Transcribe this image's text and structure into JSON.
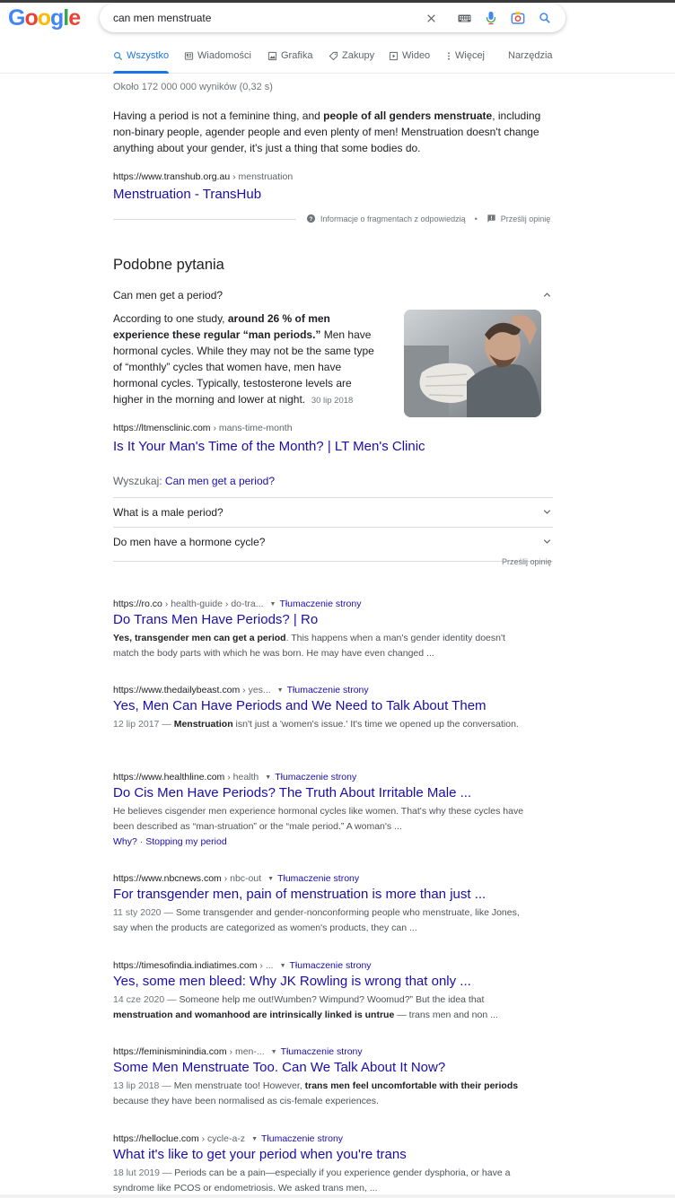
{
  "logo": {
    "letters": [
      {
        "ch": "G",
        "color": "#4285F4"
      },
      {
        "ch": "o",
        "color": "#EA4335"
      },
      {
        "ch": "o",
        "color": "#FBBC05"
      },
      {
        "ch": "g",
        "color": "#4285F4"
      },
      {
        "ch": "l",
        "color": "#34A853"
      },
      {
        "ch": "e",
        "color": "#EA4335"
      }
    ]
  },
  "search": {
    "query": "can men menstruate"
  },
  "icons": {
    "clear": "close-icon",
    "keyboard": "keyboard-icon",
    "voice": "microphone-icon",
    "lens": "camera-icon",
    "search": "search-icon"
  },
  "tabs": {
    "all": "Wszystko",
    "news": "Wiadomości",
    "images": "Grafika",
    "shopping": "Zakupy",
    "video": "Wideo",
    "more": "Więcej",
    "tools": "Narzędzia"
  },
  "stats": "Około 172 000 000 wyników (0,32 s)",
  "featured": {
    "text_pre": "Having a period is not a feminine thing, and ",
    "text_bold": "people of all genders menstruate",
    "text_post": ", including non-binary people, agender people and even plenty of men! Menstruation doesn't change anything about your gender, it's just a thing that some bodies do.",
    "cite_domain": "https://www.transhub.org.au",
    "cite_path": " › menstruation",
    "title": "Menstruation - TransHub",
    "footer_info": "Informacje o fragmentach z odpowiedzią",
    "footer_sep": "•",
    "footer_feedback": "Prześlij opinię"
  },
  "paa": {
    "heading": "Podobne pytania",
    "q1": "Can men get a period?",
    "a1_pre": "According to one study, ",
    "a1_bold": "around 26 % of men experience these regular “man periods.”",
    "a1_post": " Men have hormonal cycles. While they may not be the same type of “monthly” cycles that women have, men have hormonal cycles. Typically, testosterone levels are higher in the morning and lower at night.",
    "a1_date": "30 lip 2018",
    "a1_cite_domain": "https://ltmensclinic.com",
    "a1_cite_path": " › mans-time-month",
    "a1_title": "Is It Your Man's Time of the Month? | LT Men's Clinic",
    "search_label": "Wyszukaj: ",
    "search_link": "Can men get a period?",
    "q2": "What is a male period?",
    "q3": "Do men have a hormone cycle?",
    "feedback": "Prześlij opinię"
  },
  "results": [
    {
      "domain": "https://ro.co",
      "path": " › health-guide › do-tra...",
      "translate": "Tłumaczenie strony",
      "title": "Do Trans Men Have Periods? | Ro",
      "date": "",
      "desc_bold_pre": "Yes, transgender men can get a period",
      "desc": ". This happens when a man's gender identity doesn't match the body parts with which he was born. He may have even changed ..."
    },
    {
      "domain": "https://www.thedailybeast.com",
      "path": " › yes...",
      "translate": "Tłumaczenie strony",
      "title": "Yes, Men Can Have Periods and We Need to Talk About Them",
      "date": "12 lip 2017 — ",
      "desc_bold_pre": "Menstruation",
      "desc": " isn't just a 'women's issue.' It's time we opened up the conversation."
    },
    {
      "domain": "https://www.healthline.com",
      "path": " › health",
      "translate": "Tłumaczenie strony",
      "title": "Do Cis Men Have Periods? The Truth About Irritable Male ...",
      "date": "",
      "desc_bold_pre": "",
      "desc": "He believes cisgender men experience hormonal cycles like women. That's why these cycles have been described as “man-struation” or the “male period.” A woman's ...",
      "sitelink1": "Why?",
      "sitelink_sep": " · ",
      "sitelink2": "Stopping my period"
    },
    {
      "domain": "https://www.nbcnews.com",
      "path": " › nbc-out",
      "translate": "Tłumaczenie strony",
      "title": "For transgender men, pain of menstruation is more than just ...",
      "date": "11 sty 2020 — ",
      "desc_bold_pre": "",
      "desc": "Some transgender and gender-nonconforming people who menstruate, like Jones, say when the products are categorized as women's products, they can ..."
    },
    {
      "domain": "https://timesofindia.indiatimes.com",
      "path": " › ...",
      "translate": "Tłumaczenie strony",
      "title": "Yes, some men bleed: Why JK Rowling is wrong that only ...",
      "date": "14 cze 2020 — ",
      "desc_bold_pre": "",
      "desc": "Someone help me out!Wumben? Wimpund? Woomud?” But the idea that ",
      "desc_bold_mid": "menstruation and womanhood are intrinsically linked is untrue",
      "desc_post": " — trans men and non ..."
    },
    {
      "domain": "https://feminisminindia.com",
      "path": " › men-...",
      "translate": "Tłumaczenie strony",
      "title": "Some Men Menstruate Too. Can We Talk About It Now?",
      "date": "13 lip 2018 — ",
      "desc_bold_pre": "",
      "desc": "Men menstruate too! However, ",
      "desc_bold_mid": "trans men feel uncomfortable with their periods",
      "desc_post": " because they have been normalised as cis-female experiences."
    },
    {
      "domain": "https://helloclue.com",
      "path": " › cycle-a-z",
      "translate": "Tłumaczenie strony",
      "title": "What it's like to get your period when you're trans",
      "date": "18 lut 2019 — ",
      "desc_bold_pre": "",
      "desc": "Periods can be a pain—especially if you experience gender dysphoria, or have a syndrome like PCOS or endometriosis. We asked trans men, ..."
    }
  ]
}
